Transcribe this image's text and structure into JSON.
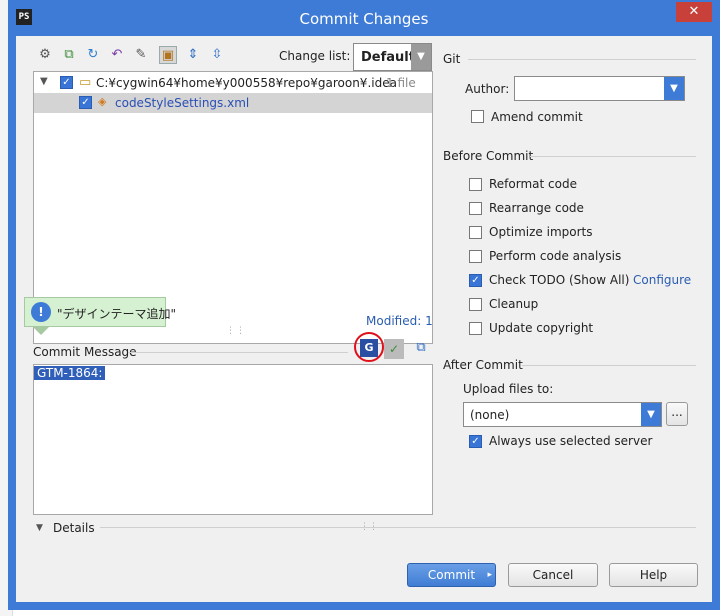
{
  "window": {
    "title": "Commit Changes",
    "app_icon_text": "PS"
  },
  "changelist": {
    "label": "Change list:",
    "value": "Default"
  },
  "tree": {
    "directory": {
      "path": "C:¥cygwin64¥home¥y000558¥repo¥garoon¥.idea",
      "count": "1 file"
    },
    "file": {
      "name": "codeStyleSettings.xml"
    },
    "modified": "Modified: 1"
  },
  "balloon": {
    "message": "\"デザインテーマ追加\""
  },
  "commit_message": {
    "label": "Commit Message",
    "text": "GTM-1864:",
    "g_icon_text": "G"
  },
  "details": {
    "label": "Details"
  },
  "git": {
    "section": "Git",
    "author_label": "Author:",
    "amend": "Amend commit"
  },
  "before_commit": {
    "section": "Before Commit",
    "options": [
      "Reformat code",
      "Rearrange code",
      "Optimize imports",
      "Perform code analysis",
      "Check TODO (Show All)",
      "Cleanup",
      "Update copyright"
    ],
    "configure": "Configure"
  },
  "after_commit": {
    "section": "After Commit",
    "upload_label": "Upload files to:",
    "upload_value": "(none)",
    "browse": "...",
    "always_use": "Always use selected server"
  },
  "buttons": {
    "commit": "Commit",
    "cancel": "Cancel",
    "help": "Help"
  },
  "colors": {
    "window_frame": "#3e7bd6",
    "close_button": "#c7413a",
    "selection": "#2f5fb8",
    "link": "#2a5db0",
    "balloon_background": "#d6f0d2",
    "annotation_circle": "#e0101a"
  }
}
